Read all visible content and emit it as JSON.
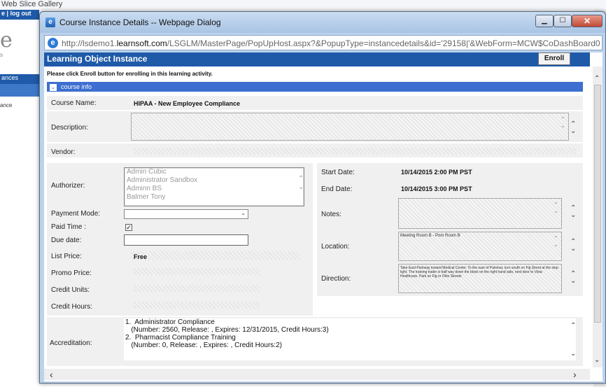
{
  "background": {
    "top_text": "Web Slice Gallery",
    "logout_text": "e | log out",
    "logo_letter": "e",
    "logo_sub": "s",
    "nav_label": "ances",
    "nav_item": "ance"
  },
  "dialog": {
    "title": "Course Instance Details -- Webpage Dialog",
    "url_prefix": "http://lsdemo1.",
    "url_domain": "learnsoft.com",
    "url_rest": "/LSGLM/MasterPage/PopUpHost.aspx?&PopupType=instancedetails&id='29158|'&WebForm=MCW$CoDashBoard0"
  },
  "page": {
    "header": "Learning Object Instance",
    "enroll_label": "Enroll",
    "notice": "Please click Enroll button for enrolling in this learning activity.",
    "section_title": "course info"
  },
  "form": {
    "course_name_label": "Course Name:",
    "course_name": "HIPAA - New Employee Compliance",
    "description_label": "Description:",
    "vendor_label": "Vendor:",
    "authorizer_label": "Authorizer:",
    "authorizers": [
      "Admin Cubic",
      "Administrator Sandbox",
      "Adminn BS",
      "Balmer Tony"
    ],
    "payment_mode_label": "Payment Mode:",
    "paid_time_label": "Paid Time :",
    "due_date_label": "Due date:",
    "list_price_label": "List Price:",
    "list_price": "Free",
    "promo_price_label": "Promo Price:",
    "credit_units_label": "Credit Units:",
    "credit_hours_label": "Credit Hours:",
    "start_date_label": "Start Date:",
    "start_date": "10/14/2015 2:00 PM PST",
    "end_date_label": "End Date:",
    "end_date": "10/14/2015 3:00 PM PST",
    "notes_label": "Notes:",
    "location_label": "Location:",
    "location": "Meeting Room B - Pom Room B",
    "direction_label": "Direction:",
    "direction": "Take East Parkway toward Medical Center. To the east of Palomar, turn south on Fig Street at the stop light. The training trailer is half way down the block on the right hand side, next door to Vista Healthcare. Park on Fig or Ohio Streets",
    "accreditation_label": "Accreditation:",
    "accreditation_lines": [
      "1.  Administrator Compliance",
      "   (Number: 2560, Release: , Expires: 12/31/2015, Credit Hours:3)",
      "",
      "2.  Pharmacist Compliance Training",
      "   (Number: 0, Release: , Expires: , Credit Hours:2)"
    ]
  },
  "icons": {
    "checkbox_checked": "✓",
    "up": "⌃",
    "down": "⌄"
  }
}
